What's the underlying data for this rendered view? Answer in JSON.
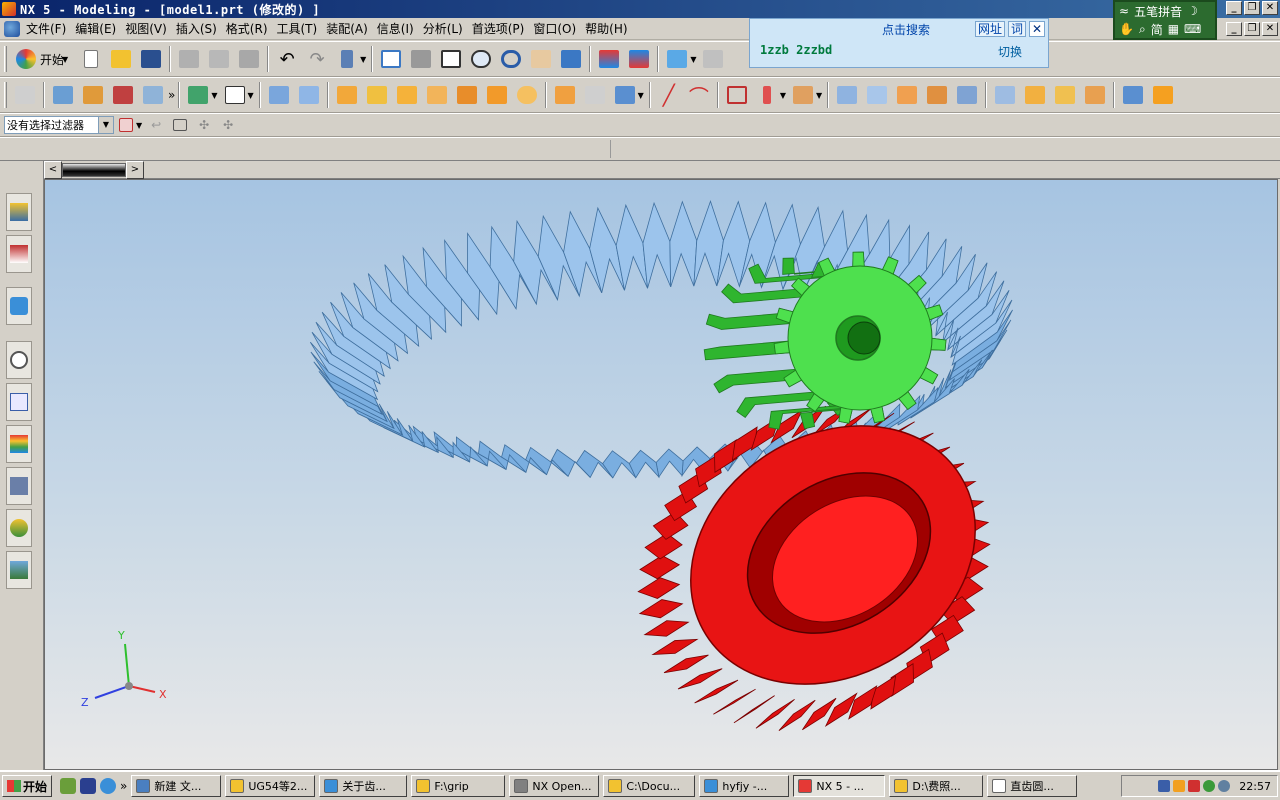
{
  "window": {
    "title": "NX 5 - Modeling - [model1.prt (修改的) ]",
    "controls": [
      "_",
      "❐",
      "✕"
    ]
  },
  "menu": [
    "文件(F)",
    "编辑(E)",
    "视图(V)",
    "插入(S)",
    "格式(R)",
    "工具(T)",
    "装配(A)",
    "信息(I)",
    "分析(L)",
    "首选项(P)",
    "窗口(O)",
    "帮助(H)"
  ],
  "toolbar": {
    "start_label": "开始",
    "more": "»"
  },
  "selection_filter": {
    "value": "没有选择过滤器"
  },
  "ime_popup": {
    "search_label": "点击搜索",
    "chip_url": "网址",
    "chip_word": "词",
    "close": "✕",
    "candidates": "1zzb 2zzbd",
    "switch_label": "切换"
  },
  "ime_bar": {
    "name": "五笔拼音",
    "mode_simplified": "简"
  },
  "graphics": {
    "triad_labels": {
      "x": "X",
      "y": "Y",
      "z": "Z"
    },
    "colors": {
      "ring_gear": "#7aaee0",
      "ring_gear_dark": "#3f6f9e",
      "pinion": "#4ee04e",
      "pinion_dark": "#1f7a1f",
      "bevel_gear": "#e01010",
      "bevel_gear_dark": "#7a0000"
    }
  },
  "taskbar": {
    "start": "开始",
    "more": "»",
    "tasks": [
      {
        "label": "新建 文...",
        "icon_color": "#4a7fc0"
      },
      {
        "label": "UG54等2...",
        "icon_color": "#f2c230"
      },
      {
        "label": "关于齿...",
        "icon_color": "#3a8fd8"
      },
      {
        "label": "F:\\grip",
        "icon_color": "#f2c230"
      },
      {
        "label": "NX Open...",
        "icon_color": "#808080"
      },
      {
        "label": "C:\\Docu...",
        "icon_color": "#f2c230"
      },
      {
        "label": "hyfjy -...",
        "icon_color": "#3a8fd8"
      },
      {
        "label": "NX 5 - ...",
        "icon_color": "#e53935"
      },
      {
        "label": "D:\\费照...",
        "icon_color": "#f2c230"
      },
      {
        "label": "直齿圆...",
        "icon_color": "#ffffff"
      }
    ],
    "clock": "22:57"
  }
}
